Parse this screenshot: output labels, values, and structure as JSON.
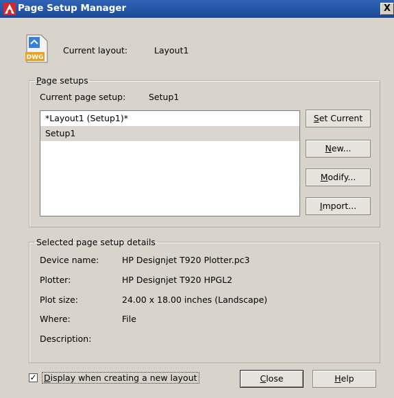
{
  "window": {
    "title": "Page Setup Manager",
    "close_glyph": "X",
    "app_icon": "autocad-logo-icon",
    "layout_icon": "dwg-file-icon",
    "dwg_icon_text": "DWG"
  },
  "current_layout": {
    "label": "Current layout:",
    "value": "Layout1"
  },
  "page_setups": {
    "legend_first": "P",
    "legend_rest": "age setups",
    "current_label": "Current page setup:",
    "current_value": "Setup1",
    "items": [
      {
        "label": "*Layout1 (Setup1)*",
        "selected": false
      },
      {
        "label": "Setup1",
        "selected": true
      }
    ],
    "buttons": {
      "set_current": {
        "mnemonic": "S",
        "rest": "et Current"
      },
      "new": {
        "mnemonic": "N",
        "rest": "ew..."
      },
      "modify": {
        "mnemonic": "M",
        "rest": "odify..."
      },
      "import": {
        "mnemonic": "I",
        "rest": "mport..."
      }
    }
  },
  "details": {
    "legend": "Selected page setup details",
    "rows": [
      {
        "label": "Device name:",
        "value": "HP Designjet T920 Plotter.pc3"
      },
      {
        "label": "Plotter:",
        "value": "HP Designjet T920 HPGL2"
      },
      {
        "label": "Plot size:",
        "value": "24.00 x 18.00 inches (Landscape)"
      },
      {
        "label": "Where:",
        "value": "File"
      },
      {
        "label": "Description:",
        "value": ""
      }
    ]
  },
  "footer": {
    "checkbox_checked": true,
    "checkbox_glyph": "✓",
    "checkbox_mnemonic": "D",
    "checkbox_rest": "isplay when creating a new layout",
    "close": {
      "mnemonic": "C",
      "rest": "lose"
    },
    "help": {
      "mnemonic": "H",
      "rest": "elp"
    }
  },
  "colors": {
    "titlebar": "#1d4a97",
    "dialog_bg": "#d8d4cb",
    "selection": "#d9d6cf",
    "autocad_red": "#d8262e"
  }
}
